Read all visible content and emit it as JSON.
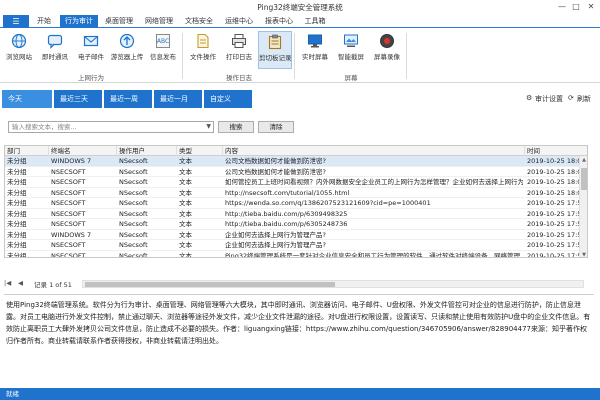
{
  "window": {
    "title": "Ping32终端安全管理系统",
    "controls": [
      "—",
      "□",
      "✕"
    ]
  },
  "menu": {
    "app_icon": "☰",
    "items": [
      "开始",
      "行为审计",
      "桌面管理",
      "网络管理",
      "文档安全",
      "运维中心",
      "报表中心",
      "工具箱"
    ],
    "active_index": 1
  },
  "ribbon": {
    "groups": [
      {
        "label": "上网行为",
        "buttons": [
          {
            "label": "浏览网站",
            "icon": "globe-icon"
          },
          {
            "label": "即时通讯",
            "icon": "chat-icon"
          },
          {
            "label": "电子邮件",
            "icon": "mail-icon"
          },
          {
            "label": "游览器上传",
            "icon": "browser-upload-icon"
          },
          {
            "label": "信息发布",
            "icon": "abc-publish-icon"
          }
        ]
      },
      {
        "label": "操作日志",
        "buttons": [
          {
            "label": "文件操作",
            "icon": "file-icon"
          },
          {
            "label": "打印日志",
            "icon": "printer-icon"
          },
          {
            "label": "剪切板记录",
            "icon": "clipboard-icon"
          }
        ]
      },
      {
        "label": "屏幕",
        "buttons": [
          {
            "label": "实时屏幕",
            "icon": "monitor-icon"
          },
          {
            "label": "智能截屏",
            "icon": "screenshot-icon"
          },
          {
            "label": "屏幕录像",
            "icon": "record-icon"
          }
        ]
      }
    ],
    "selected_button": "剪切板记录"
  },
  "date_tabs": {
    "items": [
      "今天",
      "最近三天",
      "最近一周",
      "最近一月",
      "自定义"
    ],
    "active_index": 0,
    "audit_settings": "审计设置",
    "refresh": "刷新"
  },
  "search": {
    "placeholder": "输入搜索文本，搜索...",
    "search_button": "搜索",
    "clear_button": "清除"
  },
  "table": {
    "columns": [
      "部门",
      "终端名",
      "操作用户",
      "类型",
      "内容",
      "时间"
    ],
    "rows": [
      [
        "未分组",
        "WINDOWS 7",
        "NSecsoft",
        "文本",
        "公司文档数据如何才能做到防泄密?",
        "2019-10-25 18:01:40"
      ],
      [
        "未分组",
        "NSECSOFT",
        "NSecsoft",
        "文本",
        "公司文档数据如何才能做到防泄密?",
        "2019-10-25 18:01:35"
      ],
      [
        "未分组",
        "NSECSOFT",
        "NSecsoft",
        "文本",
        "如何管控员工上班时间看视频？内外网数据安全企业员工的上网行为怎样管理？企业如何去选择上网行为管理产...",
        "2019-10-25 18:01:05"
      ],
      [
        "未分组",
        "NSECSOFT",
        "NSecsoft",
        "文本",
        "http://nsecsoft.com/tutorial/1055.html",
        "2019-10-25 18:00:50"
      ],
      [
        "未分组",
        "NSECSOFT",
        "NSecsoft",
        "文本",
        "https://wenda.so.com/q/1386207523121609?cid=pe=1000401",
        "2019-10-25 17:59:55"
      ],
      [
        "未分组",
        "NSECSOFT",
        "NSecsoft",
        "文本",
        "http://tieba.baidu.com/p/6309498325",
        "2019-10-25 17:59:50"
      ],
      [
        "未分组",
        "NSECSOFT",
        "NSecsoft",
        "文本",
        "http://tieba.baidu.com/p/6305248736",
        "2019-10-25 17:59:35"
      ],
      [
        "未分组",
        "WINDOWS 7",
        "NSecsoft",
        "文本",
        "企业如何去选择上网行为管理产品?",
        "2019-10-25 17:59:25"
      ],
      [
        "未分组",
        "NSECSOFT",
        "NSecsoft",
        "文本",
        "企业如何去选择上网行为管理产品?",
        "2019-10-25 17:59:15"
      ],
      [
        "未分组",
        "NSECSOFT",
        "NSecsoft",
        "文本",
        "Ping32终端管理系统是一套针对企业信息安全和员工行为管理的软件，通过软件对终端设备、网络管理、数据流转...",
        "2019-10-25 17:59:00"
      ]
    ],
    "selected_row": 0
  },
  "pager": {
    "first": "|◀",
    "prev": "◀",
    "status": "记录 1 of 51",
    "next": "▶",
    "last": "▶|"
  },
  "detail": {
    "text": "使用Ping32终端管理系统。软件分为行为审计、桌面管理、网络管理等六大模块，其中即时通讯、浏览器访问、电子邮件、U盘权限、外发文件管控可对企业的信息进行防护，防止信息泄露。对员工电脑进行外发文件控制，禁止通过聊天、浏览器等途径外发文件，减少企业文件泄漏的途径。对U盘进行权限设置，设置读写、只读和禁止使用有效防护U盘中的企业文件信息。有效防止离职员工大肆外发拷贝公司文件信息，防止造成不必要的损失。作者：liguangxing链接：https://www.zhihu.com/question/346705906/answer/828904477来源：知乎著作权归作者所有。商业转载请联系作者获得授权，非商业转载请注明出处。"
  },
  "status": {
    "text": "就绪"
  },
  "colors": {
    "accent": "#1f73cc",
    "selected_row": "#dbe9f7"
  }
}
